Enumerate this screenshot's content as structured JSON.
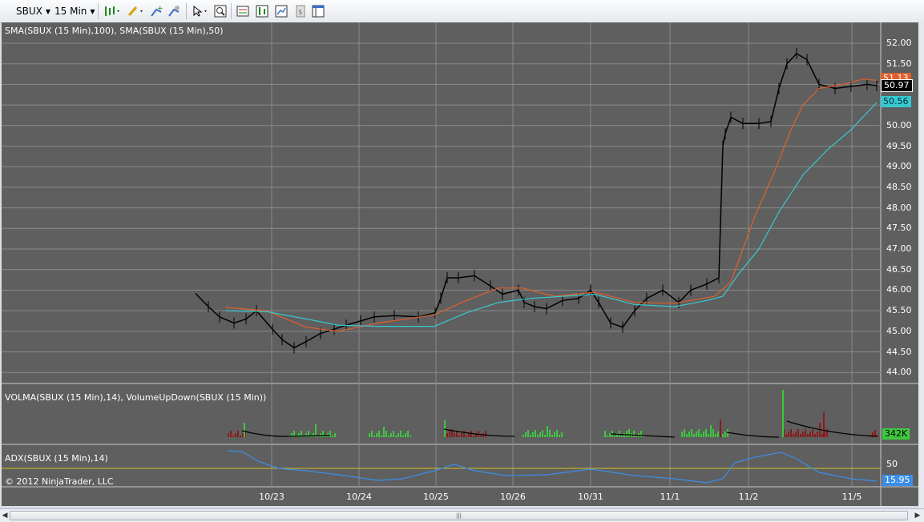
{
  "toolbar": {
    "symbol": "SBUX",
    "interval": "15 Min",
    "icons": [
      "bar-style-icon",
      "draw-pencil-icon",
      "add-indicator-icon",
      "strategy-icon",
      "cursor-icon",
      "zoom-icon",
      "data-box-icon",
      "chart-trader-icon",
      "properties-icon",
      "template-icon",
      "layout-icon"
    ]
  },
  "panels": {
    "price_label": "SMA(SBUX (15 Min),100), SMA(SBUX (15 Min),50)",
    "volume_label": "VOLMA(SBUX (15 Min),14), VolumeUpDown(SBUX (15 Min))",
    "adx_label": "ADX(SBUX (15 Min),14)",
    "copyright": "© 2012 NinjaTrader, LLC"
  },
  "price_axis": {
    "ticks": [
      "52.00",
      "51.50",
      "51.00",
      "50.50",
      "50.00",
      "49.50",
      "49.00",
      "48.50",
      "48.00",
      "47.50",
      "47.00",
      "46.50",
      "46.00",
      "45.50",
      "45.00",
      "44.50",
      "44.00"
    ],
    "badges": [
      {
        "text": "51.13",
        "color": "#e0602c",
        "text_color": "#ffffff"
      },
      {
        "text": "50.97",
        "color": "#000000",
        "text_color": "#ffffff"
      },
      {
        "text": "50.56",
        "color": "#38c8d0",
        "text_color": "#003040"
      }
    ]
  },
  "volume_axis": {
    "badge": "342K",
    "badge_color": "#3ec83e"
  },
  "adx_axis": {
    "tick": "50",
    "badge": "15.95",
    "badge_color": "#3a8ee6"
  },
  "x_axis": {
    "dates": [
      "10/23",
      "10/24",
      "10/25",
      "10/26",
      "10/31",
      "11/1",
      "11/2",
      "11/5"
    ]
  },
  "colors": {
    "background": "#5f5f5f",
    "grid": "#8a8a8a",
    "sma100": "#38c8d0",
    "sma50": "#e0602c",
    "up_volume": "#3ec83e",
    "down_volume": "#8b1a1a",
    "adx": "#3a8ee6",
    "adx_ref": "#d0c020"
  },
  "scrollbar": {
    "thumb_grip": "|||"
  }
}
